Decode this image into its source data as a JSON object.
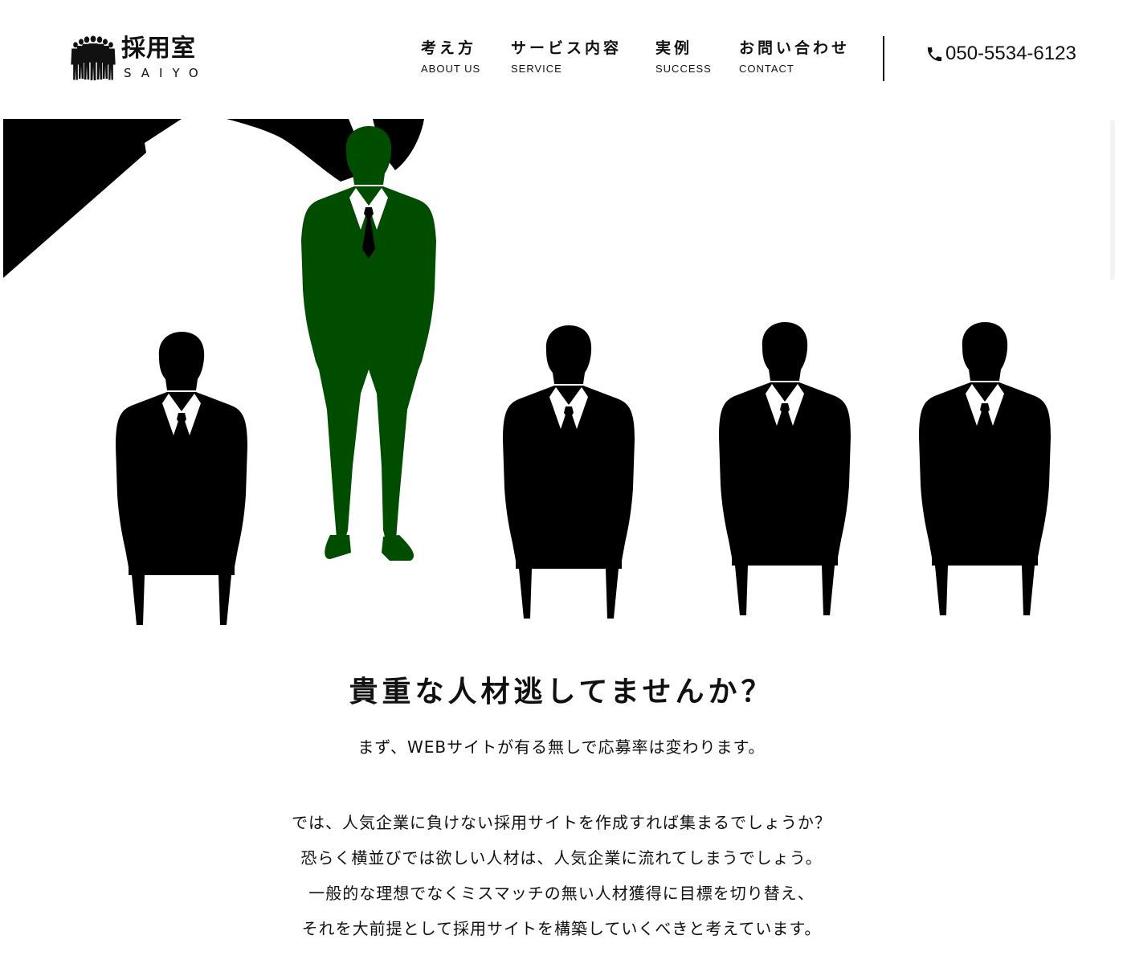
{
  "header": {
    "logo": {
      "main": "採用室",
      "sub": "SAIYO",
      "icon": "people-silhouettes-icon"
    },
    "nav": [
      {
        "jp": "考え方",
        "en": "ABOUT US"
      },
      {
        "jp": "サービス内容",
        "en": "SERVICE"
      },
      {
        "jp": "実例",
        "en": "SUCCESS"
      },
      {
        "jp": "お問い合わせ",
        "en": "CONTACT"
      }
    ],
    "phone": {
      "icon": "phone-icon",
      "number": "050-5534-6123"
    }
  },
  "hero": {
    "image": "businessmen-silhouettes-one-highlighted",
    "highlight_color": "#004d00",
    "figure_color": "#000000"
  },
  "main": {
    "headline": "貴重な人材逃してませんか？",
    "lead": "まず、WEBサイトが有る無しで応募率は変わります。",
    "body": [
      "では、人気企業に負けない採用サイトを作成すれば集まるでしょうか？",
      "恐らく横並びでは欲しい人材は、人気企業に流れてしまうでしょう。",
      "一般的な理想でなくミスマッチの無い人材獲得に目標を切り替え、",
      "それを大前提として採用サイトを構築していくべきと考えています。"
    ]
  }
}
